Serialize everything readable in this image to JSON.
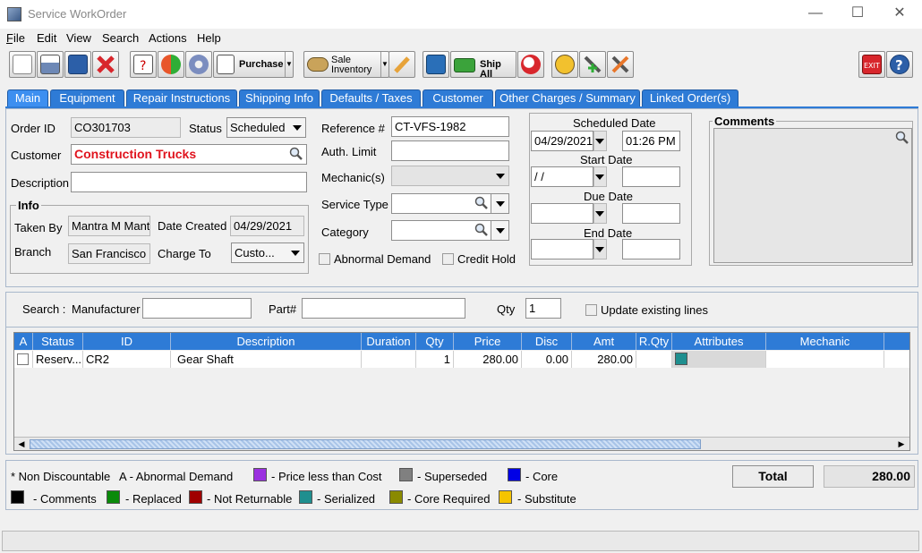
{
  "window": {
    "title": "Service WorkOrder",
    "minimize": "—",
    "maximize": "☐",
    "close": "✕"
  },
  "menu": [
    "File",
    "Edit",
    "View",
    "Search",
    "Actions",
    "Help"
  ],
  "toolbar": {
    "purchase_label": "Purchase",
    "sale_inventory_line1": "Sale",
    "sale_inventory_line2": "Inventory",
    "ship_all_label": "Ship All"
  },
  "tabs": [
    "Main",
    "Equipment",
    "Repair Instructions",
    "Shipping Info",
    "Defaults / Taxes",
    "Customer",
    "Other Charges / Summary",
    "Linked Order(s)"
  ],
  "main": {
    "order_id_label": "Order ID",
    "order_id": "CO301703",
    "status_label": "Status",
    "status": "Scheduled",
    "customer_label": "Customer",
    "customer": "Construction Trucks",
    "description_label": "Description",
    "description": "",
    "info_title": "Info",
    "taken_by_label": "Taken By",
    "taken_by": "Mantra M Mantra",
    "date_created_label": "Date Created",
    "date_created": "04/29/2021",
    "branch_label": "Branch",
    "branch": "San Francisco",
    "charge_to_label": "Charge To",
    "charge_to": "Custo...",
    "reference_label": "Reference #",
    "reference": "CT-VFS-1982",
    "auth_limit_label": "Auth. Limit",
    "auth_limit": "",
    "mechanics_label": "Mechanic(s)",
    "service_type_label": "Service Type",
    "category_label": "Category",
    "abnormal_demand_label": "Abnormal Demand",
    "credit_hold_label": "Credit Hold"
  },
  "dates": {
    "scheduled_label": "Scheduled Date",
    "scheduled_date": "04/29/2021",
    "scheduled_time": "01:26 PM",
    "start_label": "Start Date",
    "start_date": " / /",
    "due_label": "Due Date",
    "end_label": "End Date"
  },
  "comments": {
    "title": "Comments"
  },
  "search": {
    "search_label": "Search :",
    "manufacturer_label": "Manufacturer",
    "part_label": "Part#",
    "qty_label": "Qty",
    "qty": "1",
    "update_label": "Update existing lines"
  },
  "grid": {
    "columns": [
      "A",
      "Status",
      "ID",
      "Description",
      "Duration",
      "Qty",
      "Price",
      "Disc",
      "Amt",
      "R.Qty",
      "Attributes",
      "Mechanic"
    ],
    "rows": [
      {
        "status": "Reserv...",
        "id": "CR2",
        "description": "Gear Shaft",
        "duration": "",
        "qty": "1",
        "price": "280.00",
        "disc": "0.00",
        "amt": "280.00",
        "rqty": "",
        "attribute_color": "#1f8f8f",
        "mechanic": ""
      }
    ]
  },
  "legend": {
    "non_discountable": "* Non Discountable",
    "abnormal_demand": "A - Abnormal Demand",
    "items": [
      {
        "color": "#9b30e0",
        "label": "- Price less than Cost"
      },
      {
        "color": "#808080",
        "label": "- Superseded"
      },
      {
        "color": "#0000e6",
        "label": "- Core"
      },
      {
        "color": "#000000",
        "label": "- Comments"
      },
      {
        "color": "#0a8a0a",
        "label": "- Replaced"
      },
      {
        "color": "#a00000",
        "label": "- Not Returnable"
      },
      {
        "color": "#1f8f8f",
        "label": "- Serialized"
      },
      {
        "color": "#8a8a00",
        "label": "- Core Required"
      },
      {
        "color": "#f5c400",
        "label": "- Substitute"
      }
    ]
  },
  "total": {
    "label": "Total",
    "value": "280.00"
  }
}
